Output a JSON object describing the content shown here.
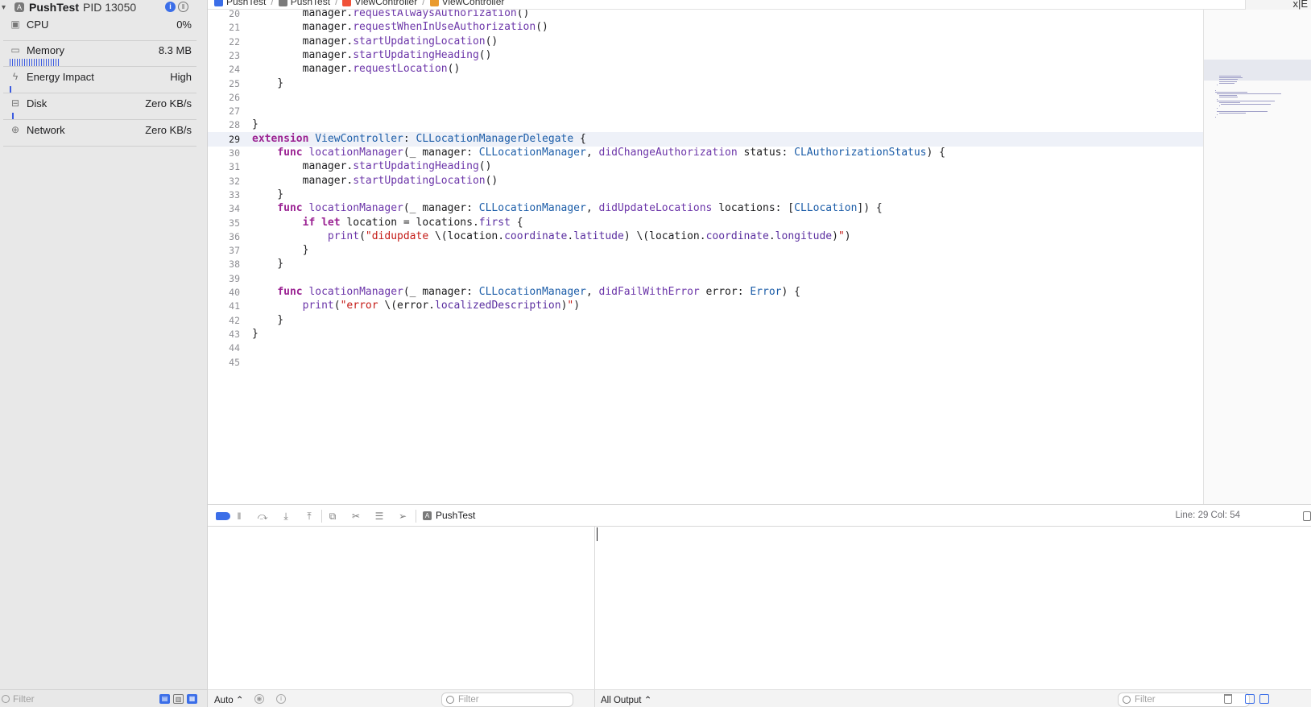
{
  "navigator": {
    "process": {
      "name": "PushTest",
      "pid": "PID 13050"
    },
    "gauges": [
      {
        "label": "CPU",
        "value": "0%",
        "icon": "cpu-icon"
      },
      {
        "label": "Memory",
        "value": "8.3 MB",
        "icon": "memory-icon"
      },
      {
        "label": "Energy Impact",
        "value": "High",
        "icon": "bolt-icon"
      },
      {
        "label": "Disk",
        "value": "Zero KB/s",
        "icon": "disk-icon"
      },
      {
        "label": "Network",
        "value": "Zero KB/s",
        "icon": "globe-icon"
      }
    ],
    "filter_placeholder": "Filter"
  },
  "jumpbar": {
    "crumbs": [
      "PushTest",
      "PushTest",
      "ViewController",
      "ViewController"
    ],
    "corner_text": "x|E"
  },
  "editor": {
    "current_line": 29,
    "lines": [
      {
        "n": "20",
        "text": "        manager.requestAlwaysAuthorization()"
      },
      {
        "n": "21",
        "text": "        manager.requestWhenInUseAuthorization()"
      },
      {
        "n": "22",
        "text": "        manager.startUpdatingLocation()"
      },
      {
        "n": "23",
        "text": "        manager.startUpdatingHeading()"
      },
      {
        "n": "24",
        "text": "        manager.requestLocation()"
      },
      {
        "n": "25",
        "text": "    }"
      },
      {
        "n": "26",
        "text": ""
      },
      {
        "n": "27",
        "text": ""
      },
      {
        "n": "28",
        "text": "}"
      },
      {
        "n": "29",
        "text": "extension ViewController: CLLocationManagerDelegate {"
      },
      {
        "n": "30",
        "text": "    func locationManager(_ manager: CLLocationManager, didChangeAuthorization status: CLAuthorizationStatus) {"
      },
      {
        "n": "31",
        "text": "        manager.startUpdatingHeading()"
      },
      {
        "n": "32",
        "text": "        manager.startUpdatingLocation()"
      },
      {
        "n": "33",
        "text": "    }"
      },
      {
        "n": "34",
        "text": "    func locationManager(_ manager: CLLocationManager, didUpdateLocations locations: [CLLocation]) {"
      },
      {
        "n": "35",
        "text": "        if let location = locations.first {"
      },
      {
        "n": "36",
        "text": "            print(\"didupdate \\(location.coordinate.latitude) \\(location.coordinate.longitude)\")"
      },
      {
        "n": "37",
        "text": "        }"
      },
      {
        "n": "38",
        "text": "    }"
      },
      {
        "n": "39",
        "text": ""
      },
      {
        "n": "40",
        "text": "    func locationManager(_ manager: CLLocationManager, didFailWithError error: Error) {"
      },
      {
        "n": "41",
        "text": "        print(\"error \\(error.localizedDescription)\")"
      },
      {
        "n": "42",
        "text": "    }"
      },
      {
        "n": "43",
        "text": "}"
      },
      {
        "n": "44",
        "text": ""
      },
      {
        "n": "45",
        "text": ""
      }
    ]
  },
  "debugbar": {
    "target": "PushTest",
    "line_col": "Line: 29  Col: 54"
  },
  "bottombar": {
    "variables_scope": "Auto ⌃",
    "variables_filter_placeholder": "Filter",
    "console_output": "All Output ⌃",
    "console_filter_placeholder": "Filter"
  },
  "colors": {
    "keyword": "#9b2393",
    "type": "#1c5da8",
    "function": "#6c36a9",
    "string": "#c41a16",
    "accent": "#3b6ee8"
  }
}
